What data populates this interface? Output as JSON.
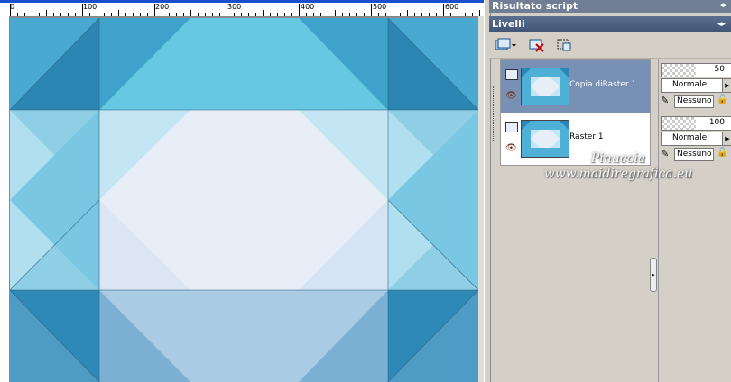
{
  "ruler": {
    "ticks": [
      "0",
      "100",
      "200",
      "300",
      "400",
      "500",
      "600"
    ]
  },
  "panels": {
    "script_title": "Risultato script",
    "layers_title": "Livelli"
  },
  "layers": [
    {
      "name": "Copia diRaster 1",
      "selected": true,
      "opacity": "50",
      "blend": "Normale",
      "mask": "Nessuno"
    },
    {
      "name": "Raster 1",
      "selected": false,
      "opacity": "100",
      "blend": "Normale",
      "mask": "Nessuno"
    }
  ],
  "watermark": {
    "line1": "Pinuccia",
    "line2": "www.maidiregrafica.eu"
  },
  "colors": {
    "dark_blue": "#2f8cb8",
    "mid_blue": "#4fb0d6",
    "light_cyan": "#66c8e2",
    "pale": "#e8eef8",
    "selection": "#7790b3"
  },
  "icons": {
    "new_layer": "new-layer-icon",
    "delete_layer": "delete-layer-icon",
    "mask": "mask-icon",
    "visibility": "eye-icon",
    "lock": "lock-icon",
    "brush": "brush-icon"
  }
}
